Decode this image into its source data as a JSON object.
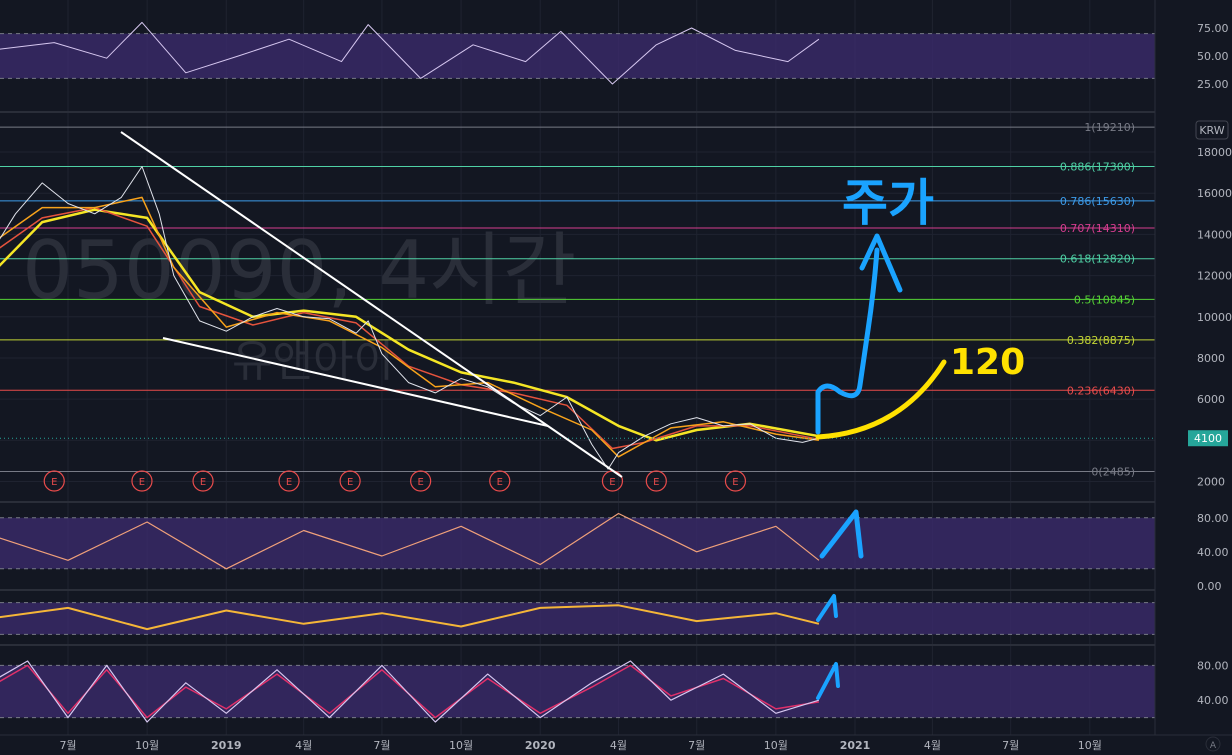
{
  "watermark": {
    "symbol_text": "050090, 4시간",
    "name_text": "유앤아이"
  },
  "currency_label": "KRW",
  "last_price_label": "4100",
  "colors": {
    "background": "#131722",
    "grid": "#1f2330",
    "price": "#e0e3eb",
    "ma_fast": "#f7a21b",
    "ma_mid": "#e5533d",
    "ma_slow": "#f5e625",
    "osc_band": "#3b2a6b",
    "rsi_line": "#d6c7f0",
    "pane2_line": "#f0a07a",
    "pane3_line": "#f5b638",
    "pane4_line_a": "#d6c7f0",
    "pane4_line_b": "#e0306a",
    "annotation_blue": "#1aa3ff",
    "annotation_yellow": "#ffe100",
    "last_price_bg": "#26a69a"
  },
  "annotations": {
    "target_text": "120",
    "ko_text": "주가"
  },
  "chart_data": [
    {
      "type": "line",
      "title": "050090, 4시간",
      "subtitle": "유앤아이",
      "y_unit": "KRW",
      "ylim": [
        1100,
        19800
      ],
      "y_ticks": [
        2000,
        4000,
        6000,
        8000,
        10000,
        12000,
        14000,
        16000,
        18000
      ],
      "y_tick_labels": [
        "2000",
        "4000",
        "6000",
        "8000",
        "10000",
        "12000",
        "14000",
        "16000",
        "18000"
      ],
      "x_tick_labels": [
        "7월",
        "10월",
        "2019",
        "4월",
        "7월",
        "10월",
        "2020",
        "4월",
        "7월",
        "10월",
        "2021",
        "4월",
        "7월",
        "10월"
      ],
      "x_tick_dates": [
        "2018-07",
        "2018-10",
        "2019-01",
        "2019-04",
        "2019-07",
        "2019-10",
        "2020-01",
        "2020-04",
        "2020-07",
        "2020-10",
        "2021-01",
        "2021-04",
        "2021-07",
        "2021-10"
      ],
      "last_price": 4100,
      "fib_levels": [
        {
          "label": "1(19210)",
          "value": 19210,
          "color": "#787b86"
        },
        {
          "label": "0.886(17300)",
          "value": 17300,
          "color": "#4fd1a5"
        },
        {
          "label": "0.786(15630)",
          "value": 15630,
          "color": "#3d9be9"
        },
        {
          "label": "0.707(14310)",
          "value": 14310,
          "color": "#d63d8f"
        },
        {
          "label": "0.618(12820)",
          "value": 12820,
          "color": "#4fd1a5"
        },
        {
          "label": "0.5(10845)",
          "value": 10845,
          "color": "#55d435"
        },
        {
          "label": "0.382(8875)",
          "value": 8875,
          "color": "#c2d435"
        },
        {
          "label": "0.236(6430)",
          "value": 6430,
          "color": "#e84b4b"
        },
        {
          "label": "0(2485)",
          "value": 2485,
          "color": "#787b86"
        }
      ],
      "earnings_marker_text": "E",
      "earnings_dates": [
        "2018-06-15",
        "2018-09-25",
        "2018-12-05",
        "2019-03-15",
        "2019-05-25",
        "2019-08-15",
        "2019-11-15",
        "2020-03-25",
        "2020-05-15",
        "2020-08-15"
      ],
      "series": [
        {
          "name": "price",
          "x": [
            "2018-04-01",
            "2018-05-01",
            "2018-06-01",
            "2018-07-01",
            "2018-08-01",
            "2018-09-01",
            "2018-09-25",
            "2018-10-15",
            "2018-11-01",
            "2018-12-01",
            "2019-01-01",
            "2019-02-01",
            "2019-03-01",
            "2019-04-01",
            "2019-05-01",
            "2019-06-01",
            "2019-06-15",
            "2019-07-01",
            "2019-08-01",
            "2019-09-01",
            "2019-10-01",
            "2019-11-01",
            "2019-12-01",
            "2020-01-01",
            "2020-02-01",
            "2020-03-01",
            "2020-03-20",
            "2020-04-01",
            "2020-05-01",
            "2020-06-01",
            "2020-07-01",
            "2020-08-01",
            "2020-09-01",
            "2020-10-01",
            "2020-11-01",
            "2020-11-20"
          ],
          "values": [
            13000,
            15000,
            16500,
            15500,
            15000,
            15800,
            17300,
            15000,
            12000,
            9800,
            9300,
            10000,
            10400,
            10000,
            9900,
            9200,
            9800,
            8200,
            6800,
            6300,
            7000,
            6600,
            5800,
            5200,
            6100,
            3800,
            2600,
            3400,
            4200,
            4800,
            5100,
            4700,
            4800,
            4100,
            3900,
            4100
          ]
        },
        {
          "name": "ma_fast",
          "x": [
            "2018-04-01",
            "2018-06-01",
            "2018-08-01",
            "2018-09-25",
            "2018-11-01",
            "2019-01-01",
            "2019-03-01",
            "2019-05-01",
            "2019-07-01",
            "2019-09-01",
            "2019-11-01",
            "2020-01-01",
            "2020-03-01",
            "2020-04-01",
            "2020-06-01",
            "2020-08-01",
            "2020-10-01",
            "2020-11-20"
          ],
          "values": [
            13500,
            15300,
            15300,
            15800,
            12400,
            9500,
            10200,
            9800,
            8500,
            6600,
            6800,
            5600,
            4500,
            3200,
            4600,
            4900,
            4300,
            4000
          ]
        },
        {
          "name": "ma_mid",
          "x": [
            "2018-04-01",
            "2018-06-01",
            "2018-08-01",
            "2018-10-01",
            "2018-12-01",
            "2019-02-01",
            "2019-04-01",
            "2019-06-01",
            "2019-08-01",
            "2019-10-01",
            "2019-12-01",
            "2020-02-01",
            "2020-03-25",
            "2020-05-01",
            "2020-07-01",
            "2020-09-01",
            "2020-11-20"
          ],
          "values": [
            13000,
            14800,
            15300,
            14400,
            10500,
            9600,
            10200,
            9700,
            7600,
            6700,
            6300,
            5700,
            3600,
            3900,
            4700,
            4700,
            4050
          ]
        },
        {
          "name": "ma_slow",
          "x": [
            "2018-04-01",
            "2018-06-01",
            "2018-08-01",
            "2018-10-01",
            "2018-12-01",
            "2019-02-01",
            "2019-04-01",
            "2019-06-01",
            "2019-08-01",
            "2019-10-01",
            "2019-12-01",
            "2020-02-01",
            "2020-04-01",
            "2020-05-15",
            "2020-07-01",
            "2020-09-01",
            "2020-11-20"
          ],
          "values": [
            12000,
            14600,
            15200,
            14800,
            11200,
            10000,
            10300,
            10000,
            8400,
            7300,
            6800,
            6100,
            4700,
            4000,
            4500,
            4800,
            4200
          ]
        }
      ]
    },
    {
      "type": "line",
      "y_ticks": [
        25,
        50,
        75
      ],
      "y_tick_labels": [
        "25.00",
        "50.00",
        "75.00"
      ],
      "band": [
        30,
        70
      ],
      "series": [
        {
          "x": [
            "2018-04-01",
            "2018-06-15",
            "2018-08-15",
            "2018-09-25",
            "2018-11-15",
            "2019-01-15",
            "2019-03-15",
            "2019-05-15",
            "2019-06-15",
            "2019-08-15",
            "2019-10-15",
            "2019-12-15",
            "2020-01-25",
            "2020-03-25",
            "2020-05-15",
            "2020-06-25",
            "2020-08-15",
            "2020-10-15",
            "2020-11-20"
          ],
          "values": [
            55,
            62,
            48,
            80,
            35,
            50,
            65,
            45,
            78,
            30,
            60,
            45,
            72,
            25,
            60,
            75,
            55,
            45,
            65
          ]
        }
      ]
    },
    {
      "type": "line",
      "y_ticks": [
        0,
        40,
        80
      ],
      "y_tick_labels": [
        "0.00",
        "40.00",
        "80.00"
      ],
      "band": [
        20,
        80
      ],
      "series": [
        {
          "x": [
            "2018-04-01",
            "2018-07-01",
            "2018-10-01",
            "2019-01-01",
            "2019-04-01",
            "2019-07-01",
            "2019-10-01",
            "2020-01-01",
            "2020-04-01",
            "2020-07-01",
            "2020-10-01",
            "2020-11-20"
          ],
          "values": [
            60,
            30,
            75,
            20,
            65,
            35,
            70,
            25,
            85,
            40,
            70,
            30
          ]
        }
      ]
    },
    {
      "type": "line",
      "band": [
        20,
        80
      ],
      "series": [
        {
          "x": [
            "2018-04-01",
            "2018-07-01",
            "2018-10-01",
            "2019-01-01",
            "2019-04-01",
            "2019-07-01",
            "2019-10-01",
            "2020-01-01",
            "2020-04-01",
            "2020-07-01",
            "2020-10-01",
            "2020-11-20"
          ],
          "values": [
            50,
            70,
            30,
            65,
            40,
            60,
            35,
            70,
            75,
            45,
            60,
            40
          ]
        }
      ]
    },
    {
      "type": "line",
      "y_ticks": [
        40,
        80
      ],
      "y_tick_labels": [
        "40.00",
        "80.00"
      ],
      "band": [
        20,
        80
      ],
      "series": [
        {
          "x": [
            "2018-04-01",
            "2018-05-15",
            "2018-07-01",
            "2018-08-15",
            "2018-10-01",
            "2018-11-15",
            "2019-01-01",
            "2019-03-01",
            "2019-05-01",
            "2019-07-01",
            "2019-09-01",
            "2019-11-01",
            "2020-01-01",
            "2020-03-01",
            "2020-04-15",
            "2020-06-01",
            "2020-08-01",
            "2020-10-01",
            "2020-11-20"
          ],
          "values": [
            60,
            85,
            20,
            80,
            15,
            60,
            25,
            75,
            20,
            80,
            15,
            70,
            20,
            60,
            85,
            40,
            70,
            25,
            40
          ]
        },
        {
          "x": [
            "2018-04-01",
            "2018-05-15",
            "2018-07-01",
            "2018-08-15",
            "2018-10-01",
            "2018-11-15",
            "2019-01-01",
            "2019-03-01",
            "2019-05-01",
            "2019-07-01",
            "2019-09-01",
            "2019-11-01",
            "2020-01-01",
            "2020-03-01",
            "2020-04-15",
            "2020-06-01",
            "2020-08-01",
            "2020-10-01",
            "2020-11-20"
          ],
          "values": [
            55,
            80,
            25,
            75,
            20,
            55,
            30,
            70,
            25,
            75,
            20,
            65,
            25,
            55,
            80,
            45,
            65,
            30,
            38
          ]
        }
      ]
    }
  ]
}
